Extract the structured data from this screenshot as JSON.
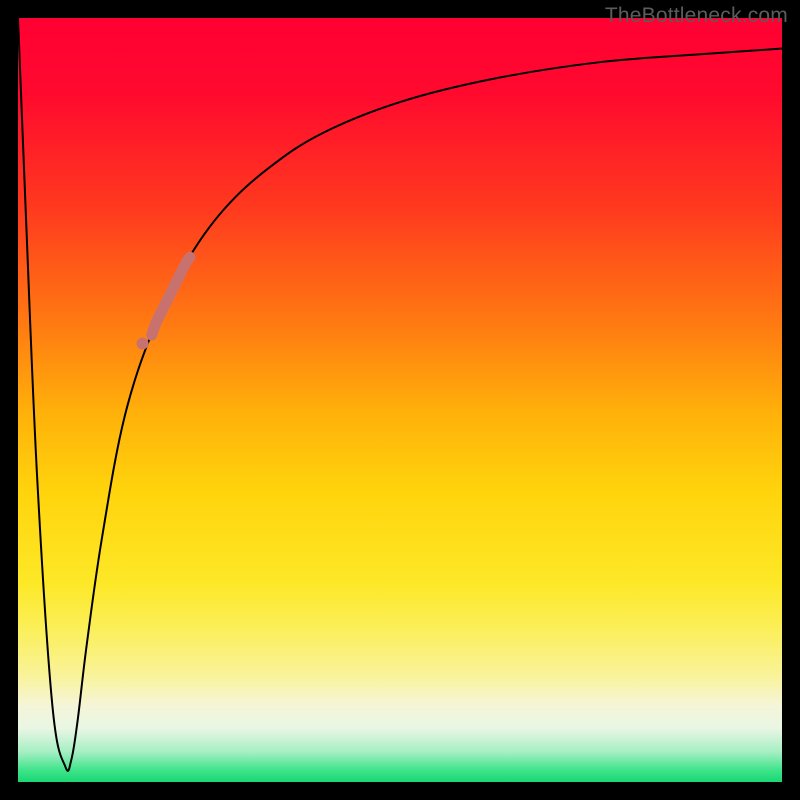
{
  "watermark": "TheBottleneck.com",
  "chart_data": {
    "type": "line",
    "title": "",
    "xlabel": "",
    "ylabel": "",
    "xlim": [
      0,
      100
    ],
    "ylim": [
      0,
      100
    ],
    "grid": false,
    "legend": false,
    "series": [
      {
        "name": "bottleneck-curve",
        "x": [
          0,
          1,
          2.5,
          4.5,
          6.2,
          7,
          7.8,
          9,
          11,
          14,
          18,
          22,
          27,
          33,
          40,
          50,
          62,
          76,
          90,
          100
        ],
        "y": [
          100,
          75,
          40,
          10,
          2,
          3,
          8,
          18,
          32,
          48,
          60,
          68,
          75,
          80.5,
          85,
          89,
          92,
          94.2,
          95.3,
          96
        ]
      }
    ],
    "highlights": {
      "segment": {
        "x_range": [
          17.5,
          22.5
        ]
      },
      "dot": {
        "x": 16.3,
        "y": 57.4
      }
    },
    "colors": {
      "curve": "#000000",
      "highlight": "#c7726f",
      "gradient_top": "#ff0033",
      "gradient_bottom": "#19d772"
    }
  }
}
